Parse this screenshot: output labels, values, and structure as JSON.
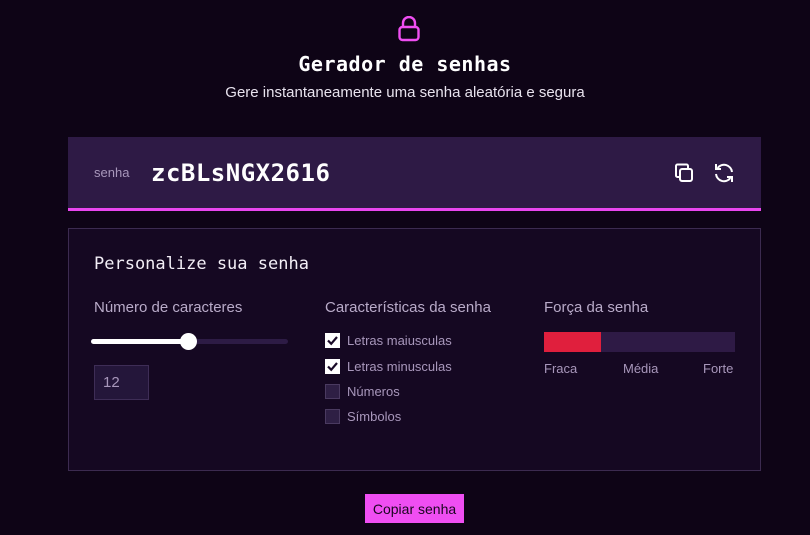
{
  "header": {
    "icon": "lock-icon",
    "title": "Gerador de senhas",
    "subtitle": "Gere instantaneamente uma senha aleatória e segura"
  },
  "password_box": {
    "label": "senha",
    "value": "zcBLsNGX2616",
    "copy_icon": "copy-icon",
    "refresh_icon": "refresh-icon"
  },
  "settings": {
    "title": "Personalize sua senha",
    "length": {
      "label": "Número de caracteres",
      "value": "12",
      "slider_fraction": 0.49
    },
    "characteristics": {
      "label": "Características da senha",
      "options": [
        {
          "label": "Letras maiusculas",
          "checked": true
        },
        {
          "label": "Letras minusculas",
          "checked": true
        },
        {
          "label": "Números",
          "checked": false
        },
        {
          "label": "Símbolos",
          "checked": false
        }
      ]
    },
    "strength": {
      "label": "Força da senha",
      "level_fraction": 0.3,
      "levels": [
        "Fraca",
        "Média",
        "Forte"
      ]
    }
  },
  "copy_button": "Copiar senha",
  "colors": {
    "background": "#0e0416",
    "accent": "#ef4ef2",
    "strength_weak": "#e01f3d",
    "panel": "#150822"
  }
}
